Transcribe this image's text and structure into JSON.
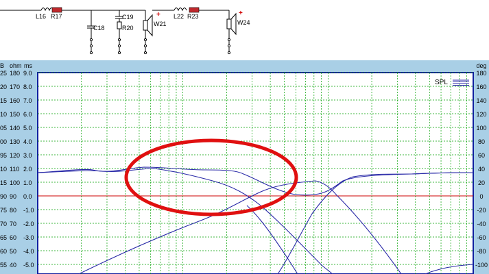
{
  "schematic": {
    "labels": {
      "l16": "L16",
      "r17": "R17",
      "c18": "C18",
      "c19": "C19",
      "r20": "R20",
      "w21": "W21",
      "l22": "L22",
      "r23": "R23",
      "w24": "W24"
    },
    "polarity_mark": "+"
  },
  "graph": {
    "left_headers": {
      "a": "B",
      "b": "ohm",
      "c": "ms"
    },
    "right_header": "deg",
    "left_rows": [
      {
        "a": "25",
        "b": "180",
        "c": "9.0"
      },
      {
        "a": "20",
        "b": "170",
        "c": "8.0"
      },
      {
        "a": "15",
        "b": "160",
        "c": "7.0"
      },
      {
        "a": "10",
        "b": "150",
        "c": "6.0"
      },
      {
        "a": "05",
        "b": "140",
        "c": "5.0"
      },
      {
        "a": "00",
        "b": "130",
        "c": "4.0"
      },
      {
        "a": "95",
        "b": "120",
        "c": "3.0"
      },
      {
        "a": "10",
        "b": "110",
        "c": "2.0"
      },
      {
        "a": "15",
        "b": "100",
        "c": "1.0"
      },
      {
        "a": "90",
        "b": "90",
        "c": "0.0"
      },
      {
        "a": "75",
        "b": "80",
        "c": "-1.0"
      },
      {
        "a": "70",
        "b": "70",
        "c": "-2.0"
      },
      {
        "a": "65",
        "b": "60",
        "c": "-3.0"
      },
      {
        "a": "60",
        "b": "50",
        "c": "-4.0"
      },
      {
        "a": "55",
        "b": "40",
        "c": "-5.0"
      }
    ],
    "right_rows": [
      "180",
      "160",
      "140",
      "120",
      "100",
      "80",
      "60",
      "40",
      "20",
      "0",
      "-20",
      "-40",
      "-60",
      "-80",
      "-100"
    ],
    "legend": "SPL",
    "colors": {
      "grid": "#00a000",
      "zero_line": "#cc0000",
      "curve": "#2a2aa8",
      "highlight": "#e01010",
      "frame": "#1020a0"
    }
  }
}
